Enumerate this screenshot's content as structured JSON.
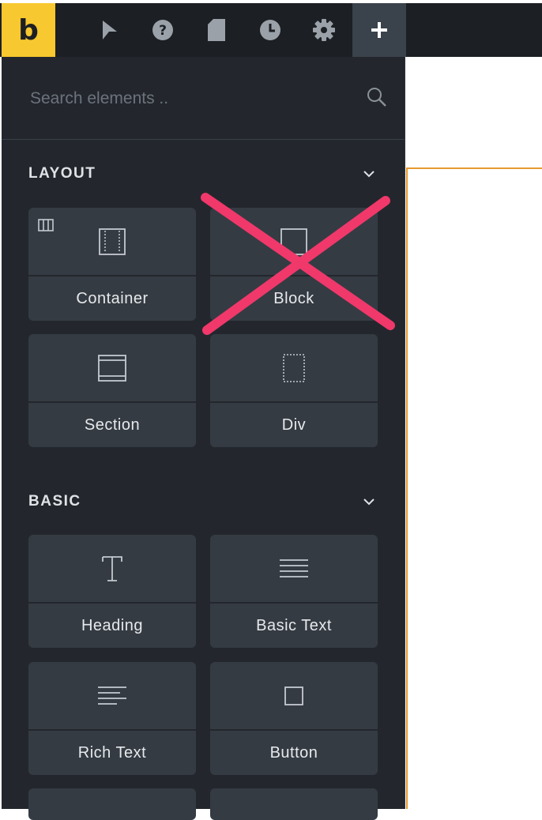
{
  "toolbar": {
    "logo_letter": "b",
    "buttons": [
      {
        "icon": "cursor-icon"
      },
      {
        "icon": "help-icon"
      },
      {
        "icon": "page-icon"
      },
      {
        "icon": "history-icon"
      },
      {
        "icon": "gear-icon"
      },
      {
        "icon": "add-icon",
        "active": true
      }
    ]
  },
  "search": {
    "placeholder": "Search elements .."
  },
  "sections": {
    "layout": {
      "title": "LAYOUT",
      "items": [
        {
          "label": "Container",
          "icon": "container-icon"
        },
        {
          "label": "Block",
          "icon": "block-icon"
        },
        {
          "label": "Section",
          "icon": "section-icon"
        },
        {
          "label": "Div",
          "icon": "div-icon"
        }
      ]
    },
    "basic": {
      "title": "BASIC",
      "items": [
        {
          "label": "Heading",
          "icon": "heading-icon"
        },
        {
          "label": "Basic Text",
          "icon": "text-lines-icon"
        },
        {
          "label": "Rich Text",
          "icon": "rich-text-icon"
        },
        {
          "label": "Button",
          "icon": "button-square-icon"
        }
      ]
    }
  },
  "colors": {
    "brand": "#f7c82f",
    "panel": "#23272d",
    "card": "#353b43",
    "accent_outline": "#e59a2e",
    "cross_mark": "#f0386b"
  }
}
